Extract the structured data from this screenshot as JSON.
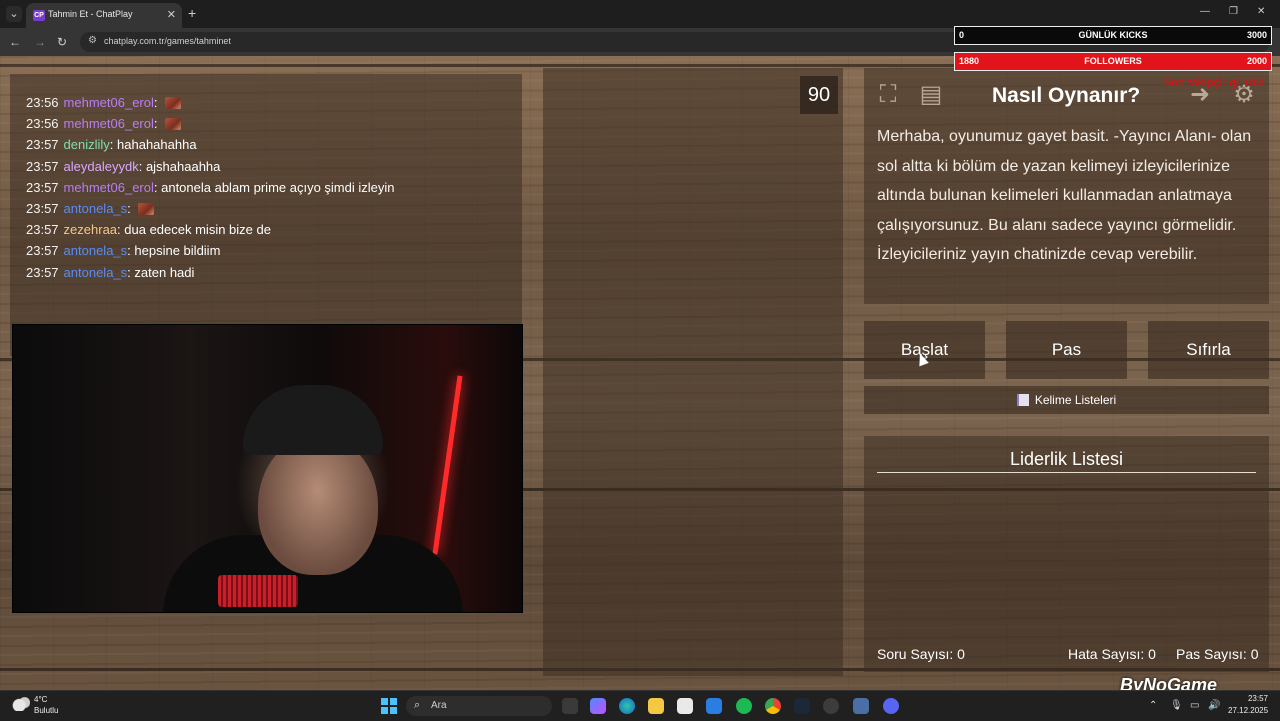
{
  "browser": {
    "tab_title": "Tahmin Et - ChatPlay",
    "tab_favicon": "CP",
    "url": "chatplay.com.tr/games/tahminet"
  },
  "chat": [
    {
      "time": "23:56",
      "user": "mehmet06_erol",
      "user_color": "#b97cf4",
      "text": "",
      "emote": true
    },
    {
      "time": "23:56",
      "user": "mehmet06_erol",
      "user_color": "#b97cf4",
      "text": "",
      "emote": true
    },
    {
      "time": "23:57",
      "user": "denizlily",
      "user_color": "#7ee0b0",
      "text": "hahahahahha",
      "emote": false
    },
    {
      "time": "23:57",
      "user": "aleydaleyydk",
      "user_color": "#d8a9ff",
      "text": "ajshahaahha",
      "emote": false
    },
    {
      "time": "23:57",
      "user": "mehmet06_erol",
      "user_color": "#b97cf4",
      "text": "antonela ablam prime açıyo şimdi izleyin",
      "emote": false
    },
    {
      "time": "23:57",
      "user": "antonela_s",
      "user_color": "#5b8cf0",
      "text": "",
      "emote": true
    },
    {
      "time": "23:57",
      "user": "zezehraa",
      "user_color": "#f3c98b",
      "text": "dua edecek misin bize de",
      "emote": false
    },
    {
      "time": "23:57",
      "user": "antonela_s",
      "user_color": "#5b8cf0",
      "text": "hepsine bildiim",
      "emote": false
    },
    {
      "time": "23:57",
      "user": "antonela_s",
      "user_color": "#5b8cf0",
      "text": "zaten hadi",
      "emote": false
    }
  ],
  "game": {
    "timer": "90",
    "howto_title": "Nasıl Oynanır?",
    "howto_text": "Merhaba, oyunumuz gayet basit. -Yayıncı Alanı- olan sol altta ki bölüm de yazan kelimeyi izleyicilerinize altında bulunan kelimeleri kullanmadan anlatmaya çalışıyorsunuz. Bu alanı sadece yayıncı görmelidir. İzleyicileriniz yayın chatinizde cevap verebilir.",
    "buttons": {
      "start": "Başlat",
      "pass": "Pas",
      "reset": "Sıfırla"
    },
    "wordlist_label": "Kelime Listeleri",
    "leaderboard_title": "Liderlik Listesi",
    "stats": {
      "questions": "Soru Sayısı: 0",
      "errors": "Hata Sayısı: 0",
      "passes": "Pas Sayısı: 0"
    }
  },
  "overlay": {
    "kicks": {
      "current": "0",
      "label": "GÜNLÜK KICKS",
      "goal": "3000"
    },
    "followers": {
      "current": "1880",
      "label": "FOLLOWERS",
      "goal": "2000"
    },
    "red_text": "Son takipçi: gl_014",
    "brand": "ByNoGame"
  },
  "taskbar": {
    "temperature": "4°C",
    "weather": "Bulutlu",
    "search_placeholder": "Ara",
    "time": "23:57",
    "date": "27.12.2025"
  }
}
